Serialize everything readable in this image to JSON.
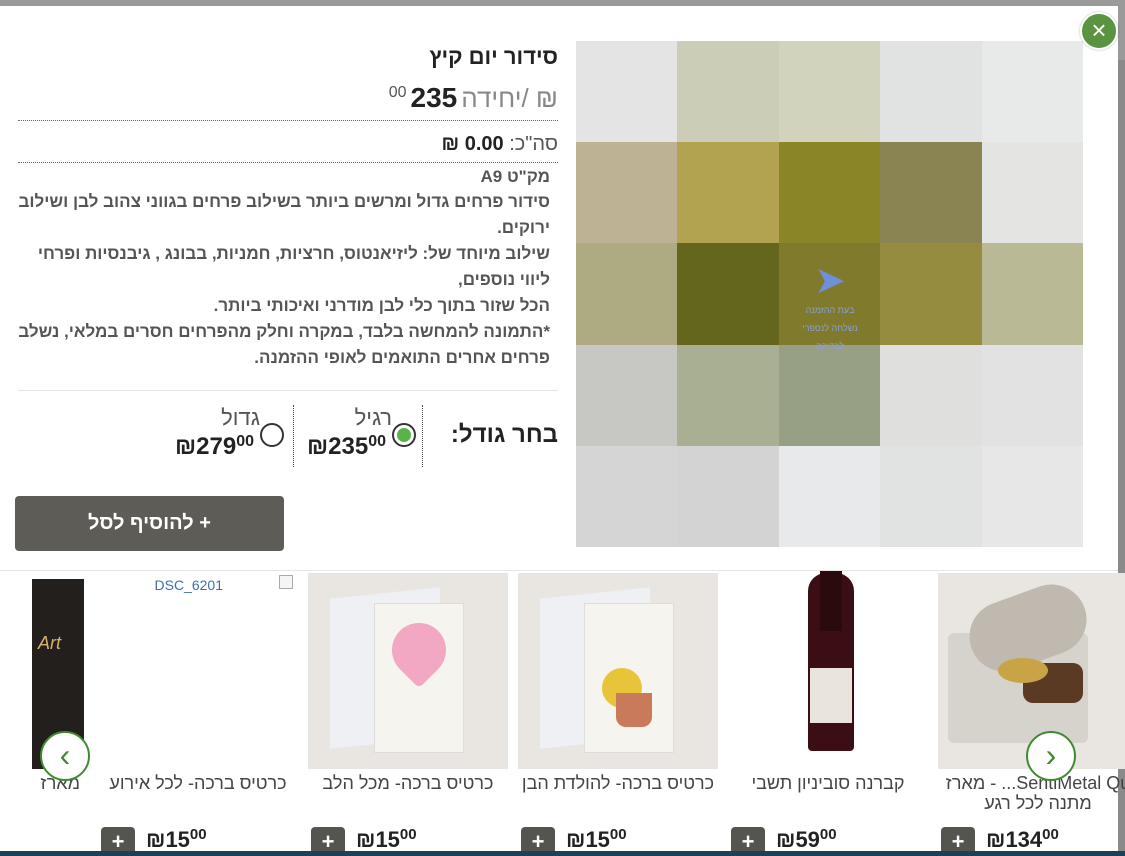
{
  "modal": {
    "close_label": "×",
    "product": {
      "title": "סידור יום קיץ",
      "unit_price_main": "235",
      "unit_price_dec": "00",
      "unit_price_suffix": "₪ /יחידה",
      "total_label": "סה\"כ:",
      "total_value": "0.00 ₪",
      "sku": "מק\"ט A9",
      "description": [
        "סידור פרחים גדול ומרשים ביותר בשילוב פרחים בגווני צהוב לבן ושילוב ירוקים.",
        "שילוב מיוחד של: ליזיאנטוס, חרציות, חמניות, בבונג , גיבנסיות ופרחי ליווי נוספים,",
        "הכל שזור בתוך כלי לבן מודרני ואיכותי ביותר.",
        "*התמונה להמחשה בלבד, במקרה וחלק מהפרחים חסרים במלאי, נשלב פרחים אחרים התואמים לאופי ההזמנה."
      ],
      "image_badge_text": "בעת ההזמנה נשלחה לנספרי לבדיקה",
      "image_colors": [
        "#e3e4e3",
        "#cbcdb7",
        "#d1d3bd",
        "#e1e3e2",
        "#e8e9e9",
        "#bdb293",
        "#b2a350",
        "#8a8628",
        "#8a8352",
        "#e4e5e3",
        "#aeaa82",
        "#64661d",
        "#807a2c",
        "#958c3f",
        "#b9b996",
        "#c7c7c3",
        "#a9af92",
        "#97a084",
        "#dfe0de",
        "#e1e2e1",
        "#d5d5d5",
        "#d4d3d4",
        "#e8e9ea",
        "#e1e2e2",
        "#e7e7e7"
      ]
    },
    "size": {
      "label": "בחר גודל:",
      "options": [
        {
          "name": "רגיל",
          "price_main": "₪235",
          "price_dec": "00",
          "selected": true
        },
        {
          "name": "גדול",
          "price_main": "₪279",
          "price_dec": "00",
          "selected": false
        }
      ]
    },
    "add_to_cart_label": "+ להוסיף לסל"
  },
  "carousel": {
    "prev_label": "‹",
    "next_label": "›",
    "items": [
      {
        "name": "SentiMetal Qu... - מארז מתנה לכל רגע",
        "price_main": "₪134",
        "price_dec": "00"
      },
      {
        "name": "קברנה סוביניון תשבי",
        "price_main": "₪59",
        "price_dec": "00"
      },
      {
        "name": "כרטיס ברכה- להולדת הבן",
        "price_main": "₪15",
        "price_dec": "00"
      },
      {
        "name": "כרטיס ברכה- מכל הלב",
        "price_main": "₪15",
        "price_dec": "00"
      },
      {
        "name": "כרטיס ברכה- לכל אירוע",
        "price_main": "₪15",
        "price_dec": "00",
        "broken_image_text": "DSC_6201"
      },
      {
        "name": "מארז",
        "price_main": "",
        "price_dec": ""
      }
    ],
    "add_label": "+"
  }
}
